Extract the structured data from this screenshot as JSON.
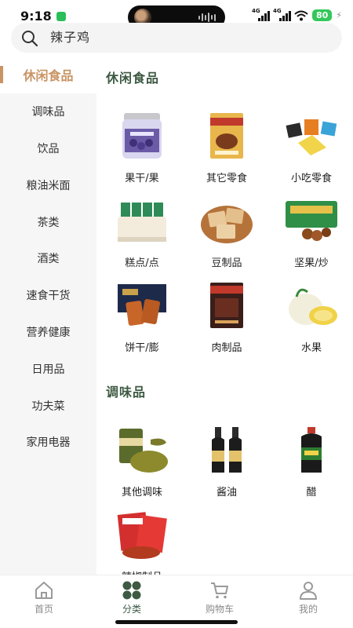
{
  "status_bar": {
    "time": "9:18",
    "network_1": "4G",
    "network_2": "4G",
    "battery": "80"
  },
  "search": {
    "value": "辣子鸡"
  },
  "sidebar": {
    "items": [
      {
        "label": "休闲食品",
        "active": true
      },
      {
        "label": "调味品"
      },
      {
        "label": "饮品"
      },
      {
        "label": "粮油米面"
      },
      {
        "label": "茶类"
      },
      {
        "label": "酒类"
      },
      {
        "label": "速食干货"
      },
      {
        "label": "营养健康"
      },
      {
        "label": "日用品"
      },
      {
        "label": "功夫菜"
      },
      {
        "label": "家用电器"
      }
    ]
  },
  "sections": [
    {
      "title": "休闲食品",
      "items": [
        {
          "label": "果干/果",
          "icon": "dried-fruit-jar-image"
        },
        {
          "label": "其它零食",
          "icon": "snack-package-image"
        },
        {
          "label": "小吃零食",
          "icon": "snack-assortment-image"
        },
        {
          "label": "糕点/点",
          "icon": "pastry-image"
        },
        {
          "label": "豆制品",
          "icon": "tofu-product-image"
        },
        {
          "label": "坚果/炒",
          "icon": "nuts-image"
        },
        {
          "label": "饼干/膨",
          "icon": "biscuit-image"
        },
        {
          "label": "肉制品",
          "icon": "meat-product-image"
        },
        {
          "label": "水果",
          "icon": "fruit-image"
        }
      ]
    },
    {
      "title": "调味品",
      "items": [
        {
          "label": "其他调味",
          "icon": "seasoning-image"
        },
        {
          "label": "酱油",
          "icon": "soy-sauce-image"
        },
        {
          "label": "醋",
          "icon": "vinegar-image"
        },
        {
          "label": "辣椒制品",
          "icon": "chili-product-image"
        }
      ]
    }
  ],
  "bottom_nav": {
    "items": [
      {
        "label": "首页",
        "icon": "home-icon"
      },
      {
        "label": "分类",
        "icon": "category-icon",
        "active": true
      },
      {
        "label": "购物车",
        "icon": "cart-icon"
      },
      {
        "label": "我的",
        "icon": "profile-icon"
      }
    ]
  },
  "colors": {
    "accent": "#c99464",
    "section_title": "#3d5a43",
    "sidebar_bg": "#f6f6f6"
  }
}
